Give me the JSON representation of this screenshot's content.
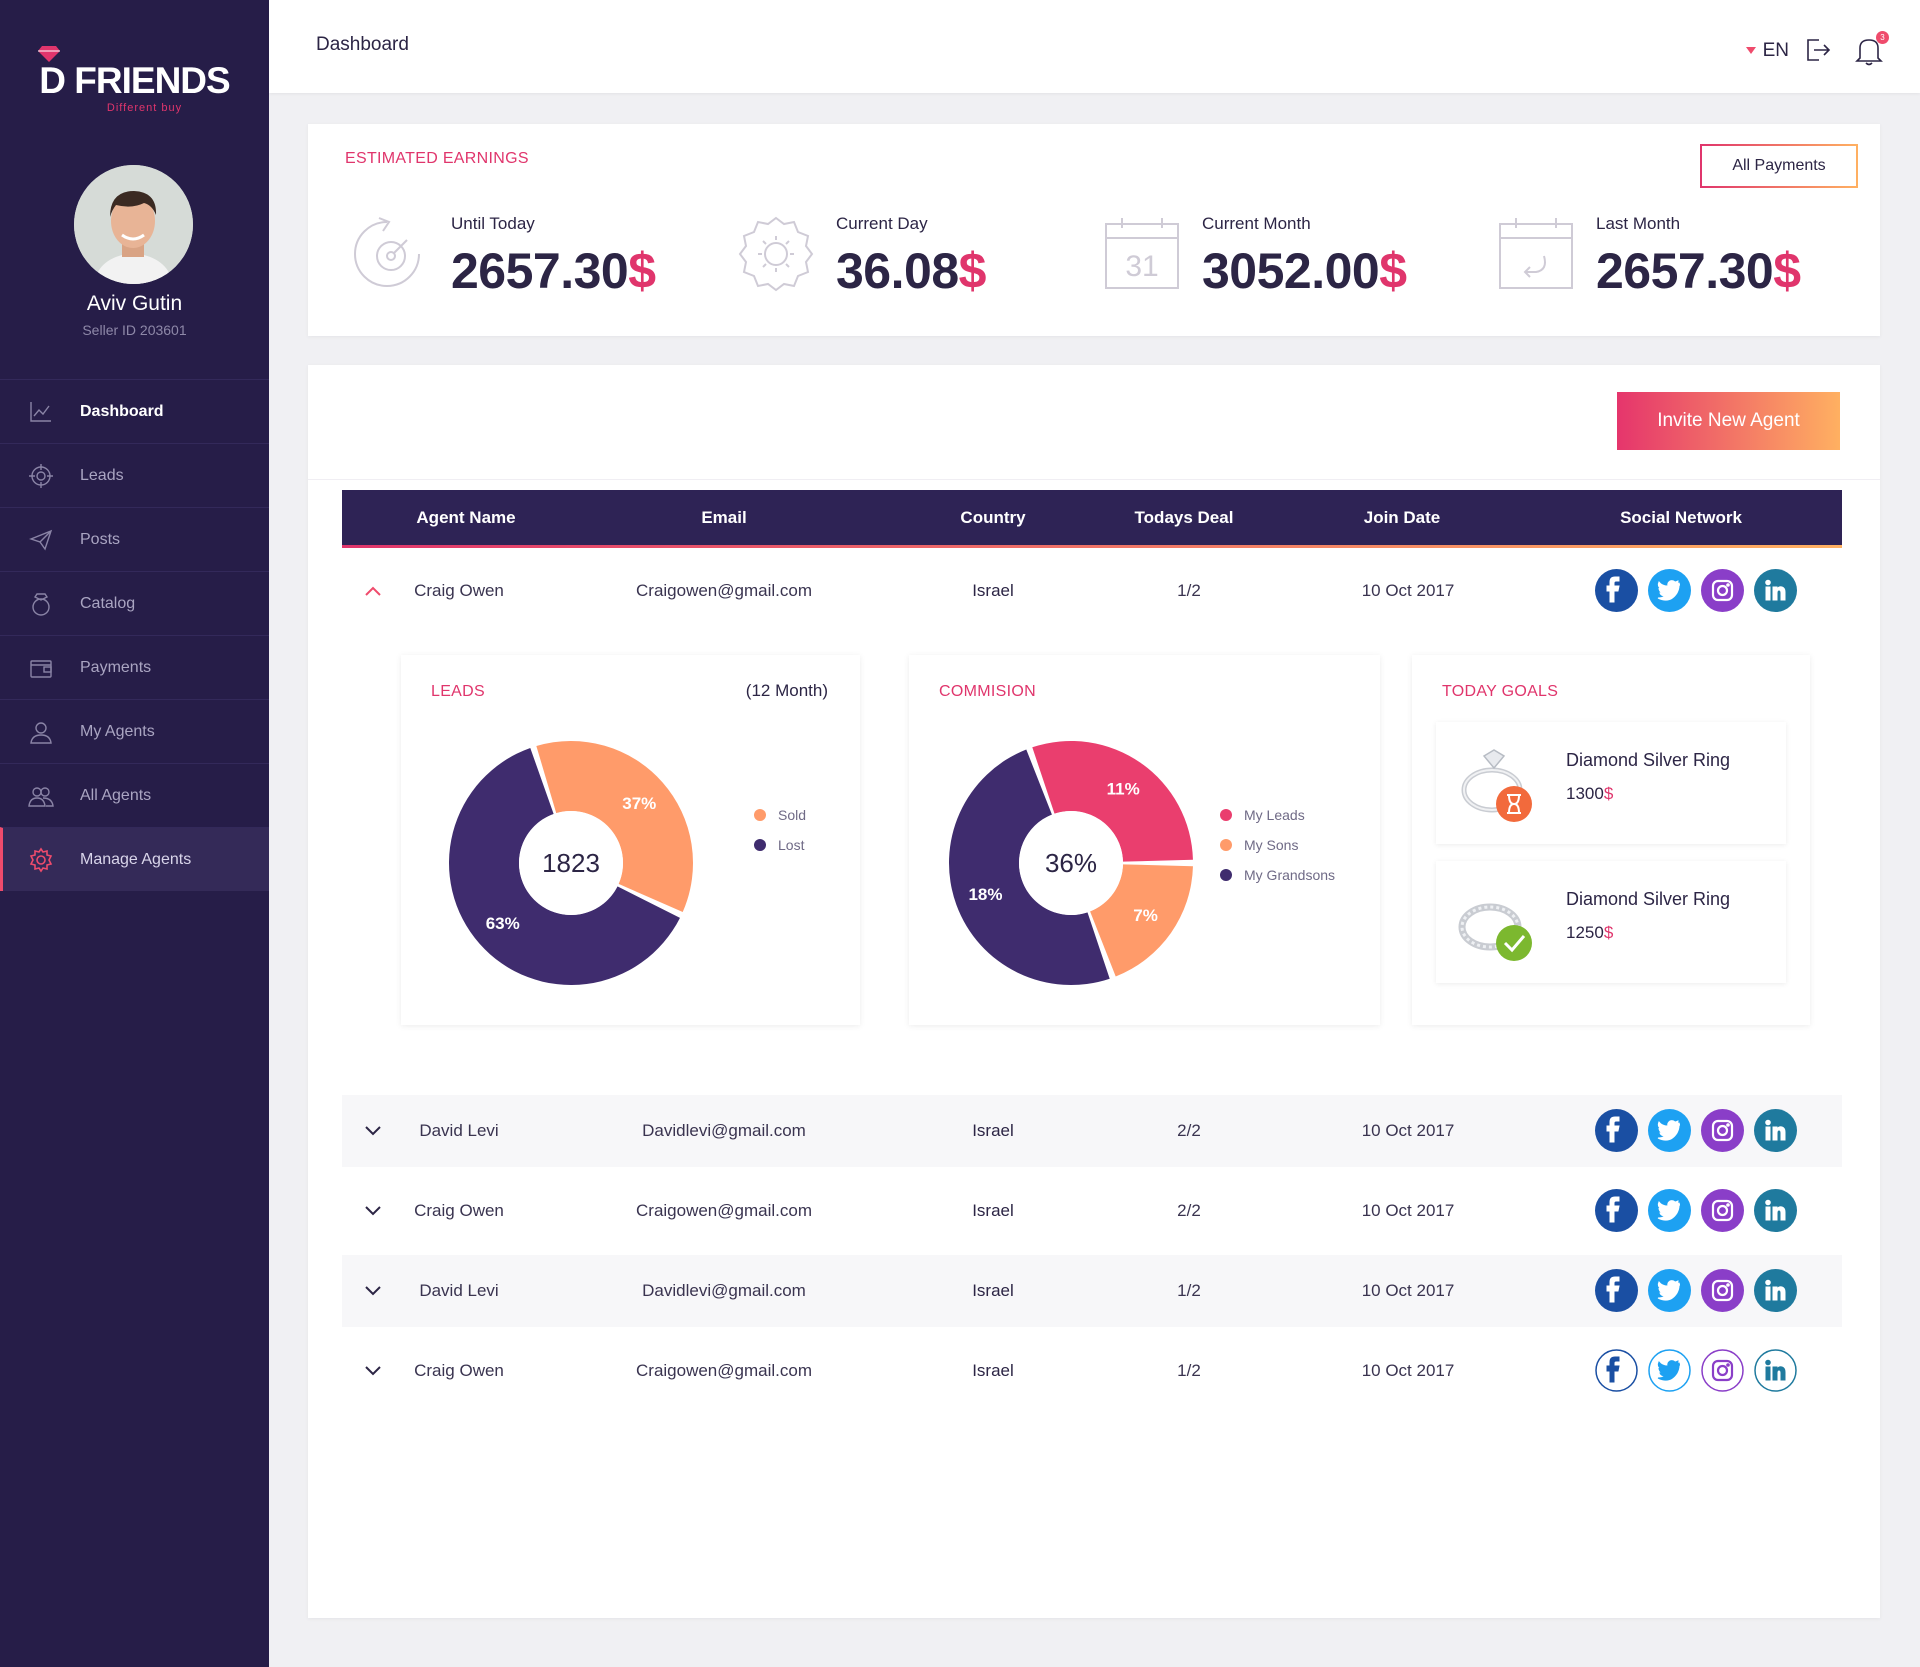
{
  "brand": {
    "name": "D FRIENDS",
    "tagline": "Different buy"
  },
  "user": {
    "name": "Aviv Gutin",
    "seller_id": "Seller ID 203601"
  },
  "nav": [
    {
      "label": "Dashboard",
      "icon": "chart-line-icon"
    },
    {
      "label": "Leads",
      "icon": "target-icon"
    },
    {
      "label": "Posts",
      "icon": "paper-plane-icon"
    },
    {
      "label": "Catalog",
      "icon": "ring-icon"
    },
    {
      "label": "Payments",
      "icon": "wallet-icon"
    },
    {
      "label": "My Agents",
      "icon": "user-icon"
    },
    {
      "label": "All Agents",
      "icon": "users-icon"
    },
    {
      "label": "Manage Agents",
      "icon": "gear-icon"
    }
  ],
  "header": {
    "title": "Dashboard",
    "language": "EN",
    "notifications": "3"
  },
  "earnings": {
    "title": "ESTIMATED EARNINGS",
    "button": "All Payments",
    "currency": "$",
    "stats": [
      {
        "label": "Until Today",
        "value": "2657.30",
        "icon": "speedometer-icon"
      },
      {
        "label": "Current Day",
        "value": "36.08",
        "icon": "sun-icon"
      },
      {
        "label": "Current Month",
        "value": "3052.00",
        "icon": "calendar-31-icon"
      },
      {
        "label": "Last Month",
        "value": "2657.30",
        "icon": "calendar-return-icon"
      }
    ]
  },
  "agents": {
    "invite_button": "Invite New Agent",
    "columns": [
      "Agent Name",
      "Email",
      "Country",
      "Todays Deal",
      "Join Date",
      "Social Network"
    ],
    "rows": [
      {
        "name": "Craig Owen",
        "email": "Craigowen@gmail.com",
        "country": "Israel",
        "deal": "1/2",
        "join": "10 Oct 2017",
        "expanded": true
      },
      {
        "name": "David Levi",
        "email": "Davidlevi@gmail.com",
        "country": "Israel",
        "deal": "2/2",
        "join": "10 Oct 2017",
        "expanded": false
      },
      {
        "name": "Craig Owen",
        "email": "Craigowen@gmail.com",
        "country": "Israel",
        "deal": "2/2",
        "join": "10 Oct 2017",
        "expanded": false
      },
      {
        "name": "David Levi",
        "email": "Davidlevi@gmail.com",
        "country": "Israel",
        "deal": "1/2",
        "join": "10 Oct 2017",
        "expanded": false
      },
      {
        "name": "Craig Owen",
        "email": "Craigowen@gmail.com",
        "country": "Israel",
        "deal": "1/2",
        "join": "10 Oct 2017",
        "expanded": false
      }
    ]
  },
  "leads_panel": {
    "title": "LEADS",
    "period": "(12 Month)",
    "center": "1823",
    "slices": [
      {
        "name": "Sold",
        "value": 37,
        "label": "37%",
        "color": "#ff9b6a"
      },
      {
        "name": "Lost",
        "value": 63,
        "label": "63%",
        "color": "#3f2c6e"
      }
    ]
  },
  "commission_panel": {
    "title": "COMMISION",
    "center": "36%",
    "slices": [
      {
        "name": "My Leads",
        "value": 11,
        "label": "11%",
        "color": "#ea3e6e"
      },
      {
        "name": "My Sons",
        "value": 7,
        "label": "7%",
        "color": "#ff9b6a"
      },
      {
        "name": "My Grandsons",
        "value": 18,
        "label": "18%",
        "color": "#3f2c6e"
      }
    ]
  },
  "goals_panel": {
    "title": "TODAY GOALS",
    "items": [
      {
        "name": "Diamond Silver Ring",
        "price": "1300",
        "status": "hourglass-icon"
      },
      {
        "name": "Diamond Silver Ring",
        "price": "1250",
        "status": "check-icon"
      }
    ]
  },
  "colors": {
    "accent": "#e0356c",
    "accent2": "#ffb061",
    "sidebar": "#261d48",
    "table_head": "#2e2355",
    "facebook": "#1a4fa3",
    "twitter": "#1da1f2",
    "instagram": "#8a3ec8",
    "linkedin": "#1f7a9e"
  }
}
